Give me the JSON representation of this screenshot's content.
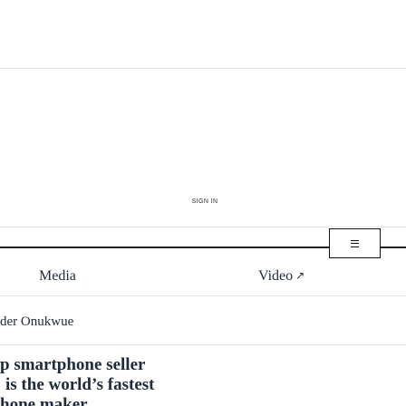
{
  "header": {
    "sign_in_label": "SIGN IN"
  },
  "nav": {
    "menu_icon": "hamburger-menu-icon",
    "links": [
      {
        "label": "Media",
        "external": false
      },
      {
        "label": "Video",
        "external": true,
        "external_icon": "external-link-arrow-icon",
        "external_glyph": "↗"
      }
    ]
  },
  "article": {
    "author": "der Onukwue",
    "headline_lines": [
      "p smartphone seller",
      "is the world’s fastest",
      "hone maker"
    ]
  }
}
